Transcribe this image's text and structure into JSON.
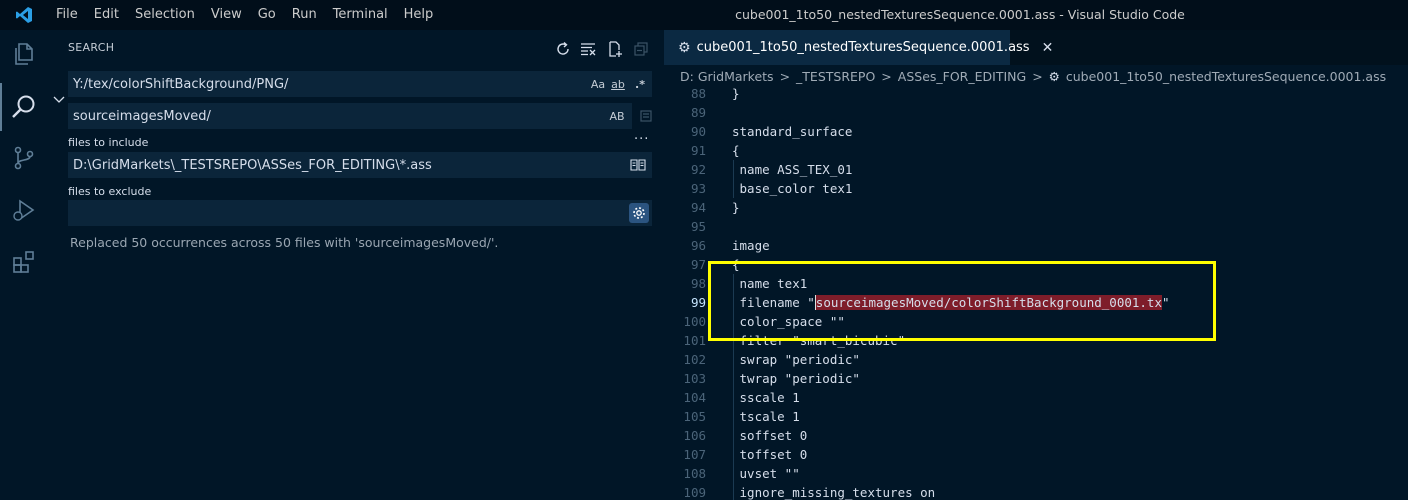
{
  "titlebar": {
    "menus": [
      "File",
      "Edit",
      "Selection",
      "View",
      "Go",
      "Run",
      "Terminal",
      "Help"
    ],
    "window_title": "cube001_1to50_nestedTexturesSequence.0001.ass - Visual Studio Code"
  },
  "sidebar": {
    "title": "SEARCH",
    "search_value": "Y:/tex/colorShiftBackground/PNG/",
    "search_options": [
      "Aa",
      "ab",
      ".*"
    ],
    "replace_value": "sourceimagesMoved/",
    "replace_option": "AB",
    "more_label": "...",
    "include_label": "files to include",
    "include_value": "D:\\GridMarkets\\_TESTSREPO\\ASSes_FOR_EDITING\\*.ass",
    "exclude_label": "files to exclude",
    "exclude_value": "",
    "result_message": "Replaced 50 occurrences across 50 files with 'sourceimagesMoved/'."
  },
  "editor": {
    "tab_label": "cube001_1to50_nestedTexturesSequence.0001.ass",
    "breadcrumb": [
      "D:",
      "GridMarkets",
      "_TESTSREPO",
      "ASSes_FOR_EDITING",
      "cube001_1to50_nestedTexturesSequence.0001.ass"
    ],
    "active_line": 99,
    "lines": [
      {
        "n": "88",
        "t": "}"
      },
      {
        "n": "89",
        "t": ""
      },
      {
        "n": "90",
        "t": "standard_surface"
      },
      {
        "n": "91",
        "t": "{"
      },
      {
        "n": "92",
        "t": " name ASS_TEX_01"
      },
      {
        "n": "93",
        "t": " base_color tex1"
      },
      {
        "n": "94",
        "t": "}"
      },
      {
        "n": "95",
        "t": ""
      },
      {
        "n": "96",
        "t": "image"
      },
      {
        "n": "97",
        "t": "{"
      },
      {
        "n": "98",
        "t": " name tex1"
      },
      {
        "n": "99",
        "pre": " filename \"",
        "hl": "sourceimagesMoved/colorShiftBackground_0001.tx",
        "post": "\""
      },
      {
        "n": "100",
        "t": " color_space \"\""
      },
      {
        "n": "101",
        "t": " filter \"smart_bicubic\""
      },
      {
        "n": "102",
        "t": " swrap \"periodic\""
      },
      {
        "n": "103",
        "t": " twrap \"periodic\""
      },
      {
        "n": "104",
        "t": " sscale 1"
      },
      {
        "n": "105",
        "t": " tscale 1"
      },
      {
        "n": "106",
        "t": " soffset 0"
      },
      {
        "n": "107",
        "t": " toffset 0"
      },
      {
        "n": "108",
        "t": " uvset \"\""
      },
      {
        "n": "109",
        "t": " ignore_missing_textures on"
      }
    ]
  },
  "colors": {
    "accent_highlight_box": "#ffff00",
    "match_highlight": "#7e1d2a",
    "background": "#011627"
  },
  "icons": {
    "activity": [
      "explorer-icon",
      "search-icon",
      "source-control-icon",
      "run-debug-icon",
      "extensions-icon"
    ],
    "search_toolbar": [
      "refresh-icon",
      "clear-results-icon",
      "new-search-editor-icon",
      "collapse-all-icon"
    ]
  }
}
